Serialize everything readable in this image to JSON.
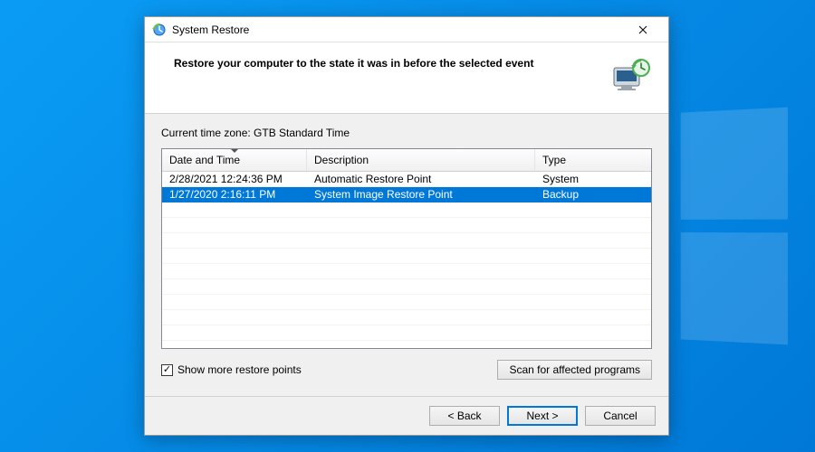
{
  "titlebar": {
    "title": "System Restore"
  },
  "header": {
    "heading": "Restore your computer to the state it was in before the selected event"
  },
  "timezone_label": "Current time zone: GTB Standard Time",
  "columns": {
    "datetime": "Date and Time",
    "description": "Description",
    "type": "Type"
  },
  "rows": [
    {
      "datetime": "2/28/2021 12:24:36 PM",
      "description": "Automatic Restore Point",
      "type": "System",
      "selected": false
    },
    {
      "datetime": "1/27/2020 2:16:11 PM",
      "description": "System Image Restore Point",
      "type": "Backup",
      "selected": true
    }
  ],
  "show_more": {
    "label": "Show more restore points",
    "checked": true
  },
  "scan_button": "Scan for affected programs",
  "buttons": {
    "back": "< Back",
    "next": "Next >",
    "cancel": "Cancel"
  }
}
